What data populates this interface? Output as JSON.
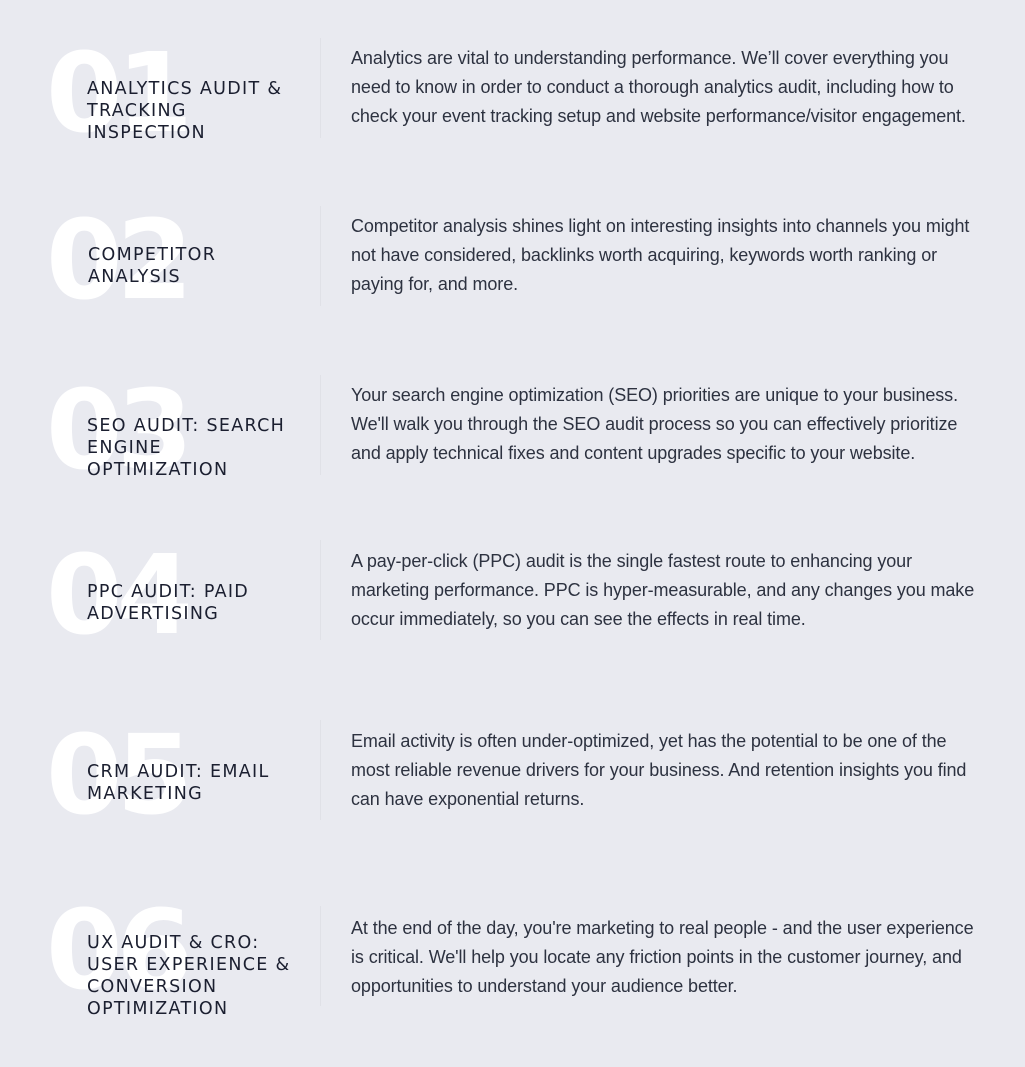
{
  "items": [
    {
      "number": "01",
      "title": "ANALYTICS AUDIT &\nTRACKING INSPECTION",
      "description": "Analytics are vital to understanding performance. We’ll cover everything you need to know in order to conduct a thorough analytics audit, including how to check your event tracking setup and website performance/visitor engagement."
    },
    {
      "number": "02",
      "title": "COMPETITOR\nANALYSIS",
      "description": "Competitor analysis shines light on interesting insights into channels you might not have considered, backlinks worth acquiring, keywords worth ranking or paying for, and more."
    },
    {
      "number": "03",
      "title": "SEO AUDIT: SEARCH\nENGINE OPTIMIZATION",
      "description": "Your search engine optimization (SEO) priorities are unique to your business. We'll walk you through the SEO audit process so you can effectively prioritize and apply technical fixes and content upgrades specific to your website."
    },
    {
      "number": "04",
      "title": "PPC AUDIT: PAID\nADVERTISING",
      "description": "A pay-per-click (PPC) audit is the single fastest route to enhancing your marketing performance. PPC is hyper-measurable, and any changes you make occur immediately, so you can see the effects in real time."
    },
    {
      "number": "05",
      "title": "CRM AUDIT: EMAIL\nMARKETING",
      "description": "Email activity is often under-optimized, yet has the potential to be one of the most reliable revenue drivers for your business. And retention insights you find can have exponential returns."
    },
    {
      "number": "06",
      "title": "UX AUDIT & CRO:\nUSER EXPERIENCE &\nCONVERSION\nOPTIMIZATION",
      "description": "At the end of the day, you're marketing to real people - and the user experience is critical. We'll help you locate any friction points in the customer journey, and opportunities to understand your audience better."
    }
  ]
}
